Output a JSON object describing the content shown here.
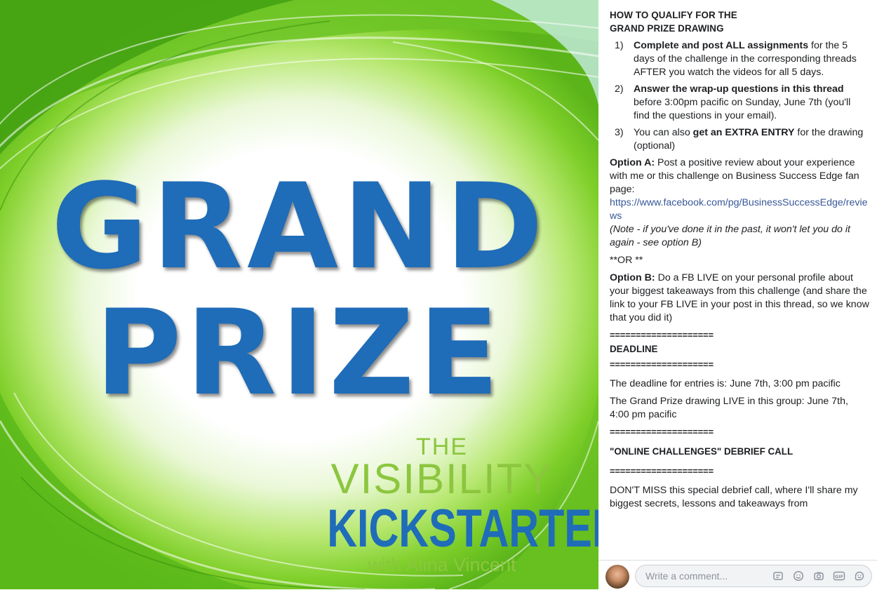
{
  "image": {
    "headline_line1": "GRAND",
    "headline_line2": "PRIZE",
    "brand_the": "THE",
    "brand_visibility": "VISIBILITY",
    "brand_kickstarter": "KICKSTARTER",
    "brand_with": "with Alina Vincent"
  },
  "post": {
    "heading_line1": "HOW TO QUALIFY FOR THE",
    "heading_line2": "GRAND PRIZE DRAWING",
    "steps": [
      {
        "num": "1)",
        "bold": "Complete and post ALL assignments",
        "text": " for the 5 days of the challenge in the corresponding threads AFTER you watch the videos for all 5 days."
      },
      {
        "num": "2)",
        "bold": "Answer the wrap-up questions in this thread",
        "text": " before 3:00pm pacific on Sunday, June 7th (you'll find the questions in your email)."
      },
      {
        "num": "3)",
        "pre": "You can also ",
        "bold": "get an EXTRA ENTRY",
        "text": " for the drawing (optional)"
      }
    ],
    "option_a_label": "Option A:",
    "option_a_text": " Post a positive review about your experience with me or this challenge on Business Success Edge fan page:",
    "option_a_link": "https://www.facebook.com/pg/BusinessSuccessEdge/reviews",
    "option_a_note": "(Note - if you've done it in the past, it won't let you do it again - see option B)",
    "or_text": "**OR **",
    "option_b_label": "Option B:",
    "option_b_text": " Do a FB LIVE on your personal profile about your biggest takeaways from this challenge (and share the link to your FB LIVE in your post in this thread, so we know that you did it)",
    "separator": "====================",
    "deadline_heading": "DEADLINE",
    "deadline_line1": "The deadline for entries is: June 7th, 3:00 pm pacific",
    "deadline_line2": "The Grand Prize drawing LIVE in this group: June 7th, 4:00 pm pacific",
    "debrief_heading": "\"ONLINE CHALLENGES\" DEBRIEF CALL",
    "debrief_text": "DON'T MISS this special debrief call, where I'll share my biggest secrets, lessons and takeaways from"
  },
  "comment": {
    "placeholder": "Write a comment...",
    "icons": [
      "sticker-icon",
      "emoji-icon",
      "camera-icon",
      "gif-icon",
      "avatar-sticker-icon"
    ]
  },
  "colors": {
    "headline_blue": "#1f6cb8",
    "brand_green": "#8cc63f",
    "link_blue": "#385898"
  }
}
